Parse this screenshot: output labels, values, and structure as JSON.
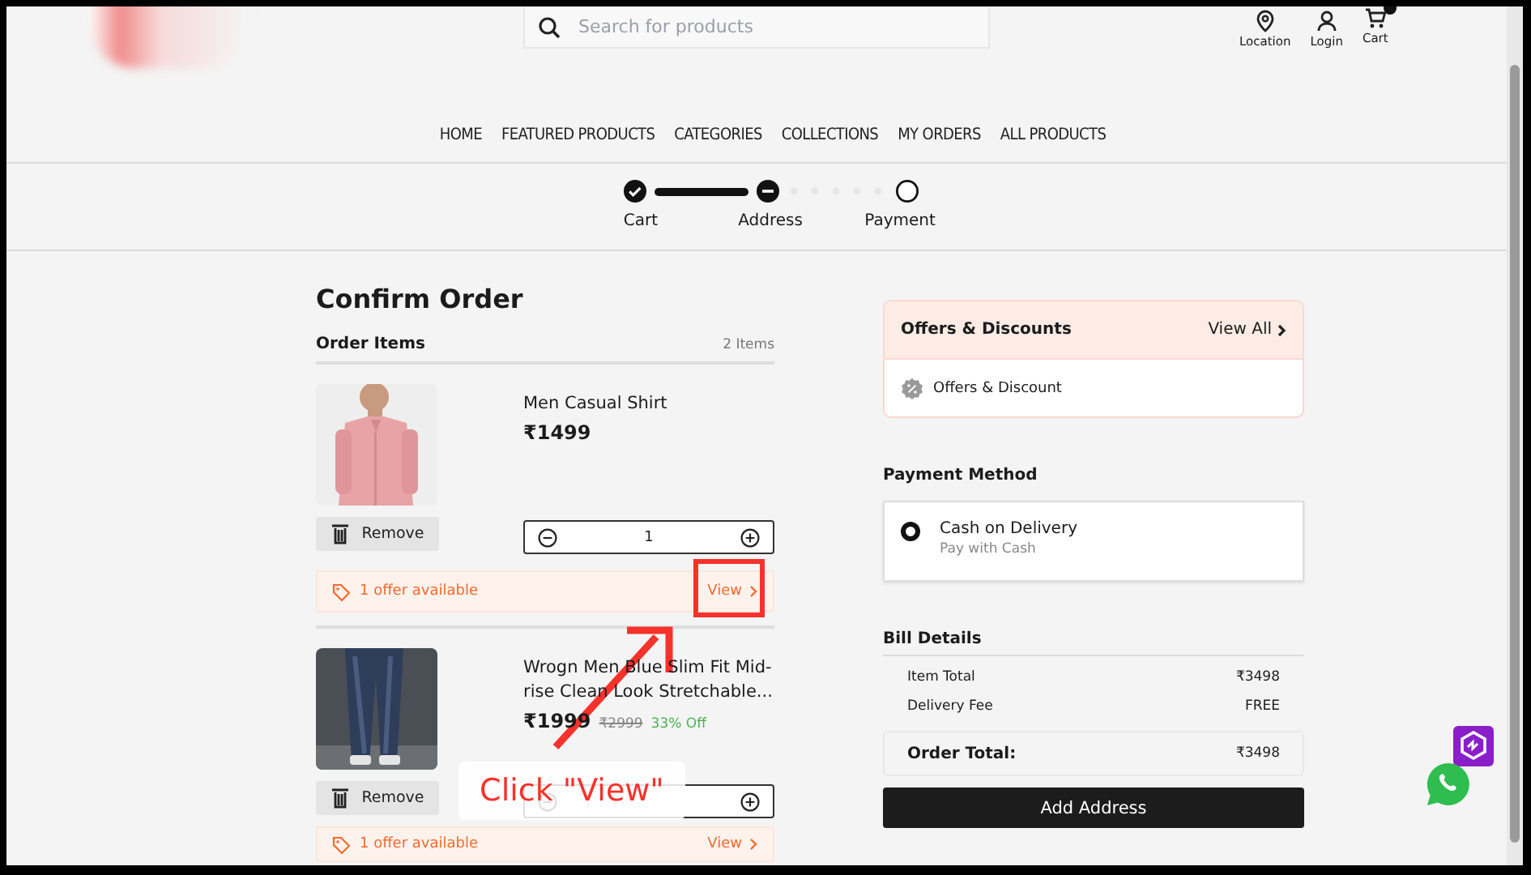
{
  "header": {
    "search": {
      "placeholder": "Search for products"
    },
    "actions": [
      {
        "label": "Location",
        "kind": "pin"
      },
      {
        "label": "Login",
        "kind": "person"
      },
      {
        "label": "Cart",
        "kind": "cart"
      }
    ]
  },
  "nav": [
    "HOME",
    "FEATURED PRODUCTS",
    "CATEGORIES",
    "COLLECTIONS",
    "MY ORDERS",
    "ALL PRODUCTS"
  ],
  "stepper": [
    {
      "label": "Cart",
      "completed": true,
      "current": false
    },
    {
      "label": "Address",
      "completed": false,
      "current": true
    },
    {
      "label": "Payment",
      "completed": false,
      "current": false
    }
  ],
  "page_title": "Confirm Order",
  "order_items": {
    "title": "Order Items",
    "count": "2 Items",
    "items": [
      {
        "kind": "shirt",
        "name": "Men Casual Shirt",
        "price": "₹1499",
        "quantity": "1",
        "remove": "Remove",
        "offer": "1 offer available",
        "offer_link": "View"
      },
      {
        "kind": "jeans",
        "name": "Wrogn Men Blue Slim Fit Mid-rise Clean Look Stretchable...",
        "price": "₹1999",
        "mrp": "₹2999",
        "discount": "33% Off",
        "remove": "Remove",
        "offer": "1 offer available",
        "offer_link": "View"
      }
    ]
  },
  "offers": {
    "title": "Offers & Discounts",
    "link": "View All",
    "items": [
      "Offers & Discount"
    ]
  },
  "payment": {
    "title": "Payment Method",
    "options": [
      {
        "label": "Cash on Delivery",
        "sub": "Pay with Cash",
        "selected": true
      }
    ]
  },
  "bill": {
    "title": "Bill Details",
    "rows": [
      {
        "label": "Item Total",
        "value": "₹3498"
      },
      {
        "label": "Delivery Fee",
        "value": "FREE"
      }
    ],
    "total": {
      "label": "Order Total:",
      "value": "₹3498"
    },
    "button": "Add Address"
  },
  "annotation": {
    "text": "Click \"View\""
  }
}
